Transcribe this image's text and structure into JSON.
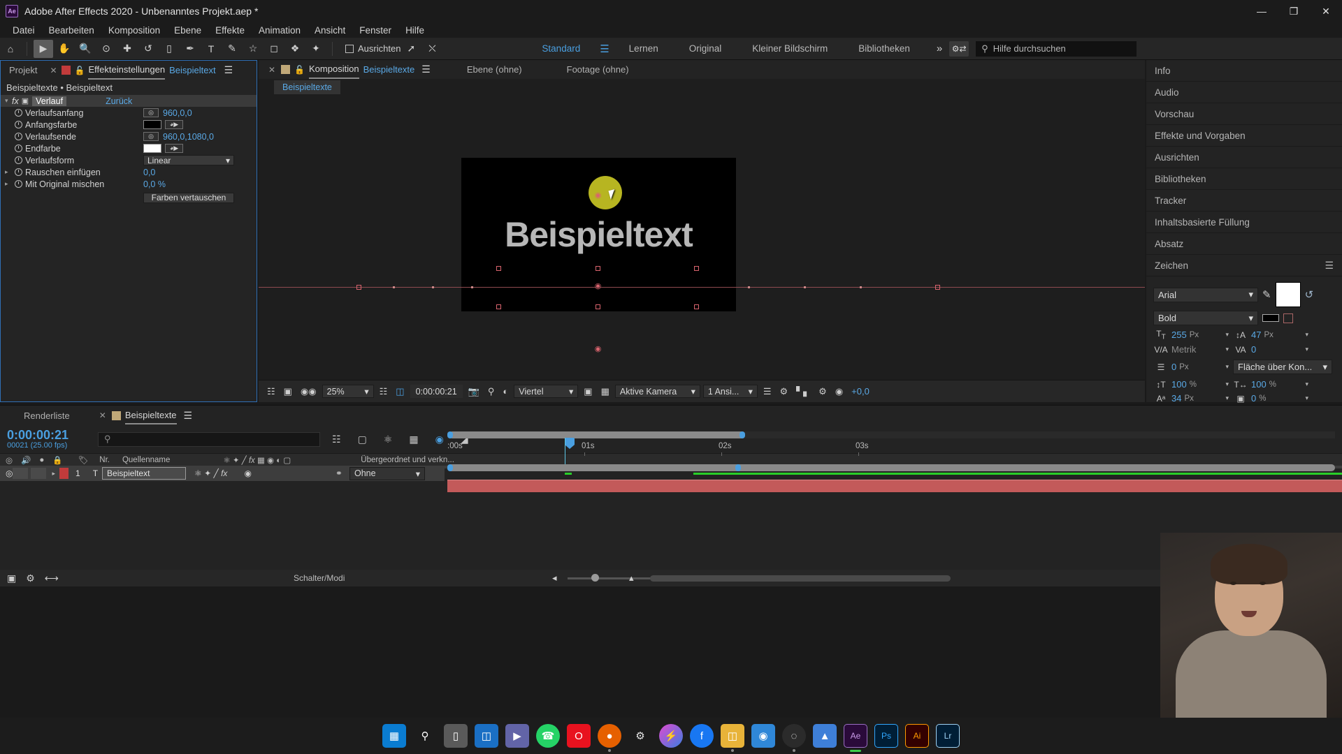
{
  "window": {
    "app_icon": "Ae",
    "title": "Adobe After Effects 2020 - Unbenanntes Projekt.aep *",
    "minimize": "—",
    "maximize": "❐",
    "close": "✕"
  },
  "menubar": {
    "items": [
      "Datei",
      "Bearbeiten",
      "Komposition",
      "Ebene",
      "Effekte",
      "Animation",
      "Ansicht",
      "Fenster",
      "Hilfe"
    ]
  },
  "toolbar": {
    "align_label": "Ausrichten",
    "workspaces": [
      "Standard",
      "Lernen",
      "Original",
      "Kleiner Bildschirm",
      "Bibliotheken"
    ],
    "active_workspace": "Standard",
    "overflow": "»",
    "help_placeholder": "Hilfe durchsuchen"
  },
  "effect_controls": {
    "tabs": [
      {
        "label": "Projekt",
        "active": false
      },
      {
        "label": "Effekteinstellungen",
        "active": true
      }
    ],
    "tab_target": "Beispieltext",
    "breadcrumb": "Beispieltexte • Beispieltext",
    "effect_name": "Verlauf",
    "reset_label": "Zurück",
    "properties": [
      {
        "name": "Verlaufsanfang",
        "type": "point",
        "value": "960,0,0"
      },
      {
        "name": "Anfangsfarbe",
        "type": "color",
        "color": "#000000"
      },
      {
        "name": "Verlaufsende",
        "type": "point",
        "value": "960,0,1080,0"
      },
      {
        "name": "Endfarbe",
        "type": "color",
        "color": "#ffffff"
      },
      {
        "name": "Verlaufsform",
        "type": "select",
        "value": "Linear"
      },
      {
        "name": "Rauschen einfügen",
        "type": "number",
        "value": "0,0",
        "expandable": true
      },
      {
        "name": "Mit Original mischen",
        "type": "number",
        "value": "0,0 %",
        "expandable": true
      }
    ],
    "swap_button": "Farben vertauschen"
  },
  "composition": {
    "tabs": [
      {
        "label": "Komposition",
        "name": "Beispieltexte",
        "active": true
      },
      {
        "label": "Ebene (ohne)",
        "name": "",
        "active": false
      },
      {
        "label": "Footage (ohne)",
        "name": "",
        "active": false
      }
    ],
    "breadcrumb_chip": "Beispieltexte",
    "canvas_text": "Beispieltext",
    "viewer_toolbar": {
      "zoom": "25%",
      "timecode": "0:00:00:21",
      "resolution": "Viertel",
      "camera": "Aktive Kamera",
      "views": "1 Ansi...",
      "exposure": "+0,0"
    }
  },
  "right_dock": {
    "panels": [
      "Info",
      "Audio",
      "Vorschau",
      "Effekte und Vorgaben",
      "Ausrichten",
      "Bibliotheken",
      "Tracker",
      "Inhaltsbasierte Füllung",
      "Absatz"
    ],
    "character_panel_title": "Zeichen",
    "character": {
      "font_family": "Arial",
      "font_style": "Bold",
      "font_size": "255",
      "font_size_unit": "Px",
      "leading": "47",
      "leading_unit": "Px",
      "kerning": "Metrik",
      "tracking": "0",
      "stroke_width": "0",
      "stroke_width_unit": "Px",
      "stroke_type": "Fläche über Kon...",
      "vertical_scale": "100",
      "horizontal_scale": "100",
      "scale_unit": "%",
      "baseline_shift": "34",
      "baseline_unit": "Px",
      "tsume": "0",
      "tsume_unit": "%",
      "fill_color": "#ffffff",
      "stroke_color": "#000000"
    }
  },
  "timeline": {
    "tabs": [
      {
        "label": "Renderliste",
        "active": false
      },
      {
        "label": "Beispieltexte",
        "active": true
      }
    ],
    "current_time": "0:00:00:21",
    "frame_info": "00021 (25.00 fps)",
    "search_placeholder": "",
    "columns": [
      "Nr.",
      "Quellenname"
    ],
    "parent_column": "Übergeordnet und verkn...",
    "layers": [
      {
        "index": "1",
        "type_icon": "T",
        "name": "Beispieltext",
        "parent": "Ohne",
        "color": "#c13b3b"
      }
    ],
    "ruler_labels": [
      ":00s",
      "01s",
      "02s",
      "03s"
    ],
    "switches_label": "Schalter/Modi"
  },
  "taskbar": {
    "items": [
      {
        "name": "start-button",
        "glyph": "⊞",
        "color": "#0a7cd1"
      },
      {
        "name": "search-icon",
        "glyph": "⌕",
        "color": "transparent"
      },
      {
        "name": "task-view-icon",
        "glyph": "❐",
        "color": "#5a5a5a"
      },
      {
        "name": "widgets-icon",
        "glyph": "◫",
        "color": "#1a6fc4"
      },
      {
        "name": "teams-icon",
        "glyph": "▶",
        "color": "#6264a7"
      },
      {
        "name": "whatsapp-icon",
        "glyph": "✆",
        "color": "#25d366"
      },
      {
        "name": "opera-icon",
        "glyph": "O",
        "color": "#e8121f"
      },
      {
        "name": "firefox-icon",
        "glyph": "◐",
        "color": "#e66000"
      },
      {
        "name": "blender-icon",
        "glyph": "⚙",
        "color": "#dcdcdc"
      },
      {
        "name": "messenger-icon",
        "glyph": "⚡",
        "color": "#c034c0"
      },
      {
        "name": "facebook-icon",
        "glyph": "f",
        "color": "#1877f2"
      },
      {
        "name": "explorer-icon",
        "glyph": "Ὄ1",
        "color": "#e8b339"
      },
      {
        "name": "app-icon",
        "glyph": "◉",
        "color": "#2f87d8"
      },
      {
        "name": "obs-icon",
        "glyph": "◎",
        "color": "#3a3a3a"
      },
      {
        "name": "vlc-icon",
        "glyph": "▲",
        "color": "#3e7fd8"
      },
      {
        "name": "after-effects-icon",
        "glyph": "Ae",
        "color": "#2a0a3a",
        "active": true
      },
      {
        "name": "photoshop-icon",
        "glyph": "Ps",
        "color": "#001e36"
      },
      {
        "name": "illustrator-icon",
        "glyph": "Ai",
        "color": "#330000"
      },
      {
        "name": "lightroom-icon",
        "glyph": "Lr",
        "color": "#001e36"
      }
    ]
  }
}
